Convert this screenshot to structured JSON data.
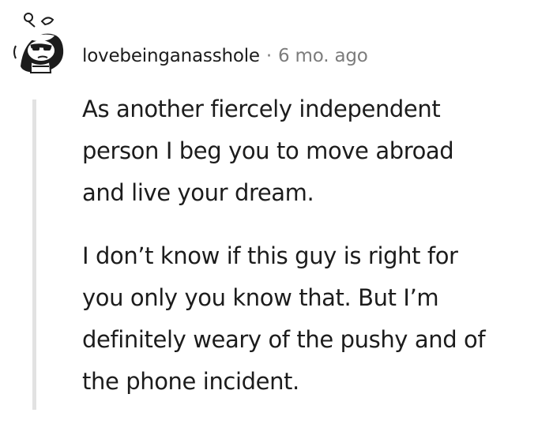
{
  "comment": {
    "author": "lovebeinganasshole",
    "separator": "·",
    "timestamp": "6 mo. ago",
    "avatar_icon": "snoo-avatar-icon",
    "paragraphs": [
      "As another fiercely independent\nperson I beg you to move abroad\nand live your dream.",
      "I don’t know if this guy is right for\nyou only you know that. But I’m\ndefinitely weary of the pushy and of\nthe phone incident."
    ]
  },
  "colors": {
    "text": "#1c1c1c",
    "muted": "#7c7c7c",
    "thread_line": "#e2e2e2"
  }
}
